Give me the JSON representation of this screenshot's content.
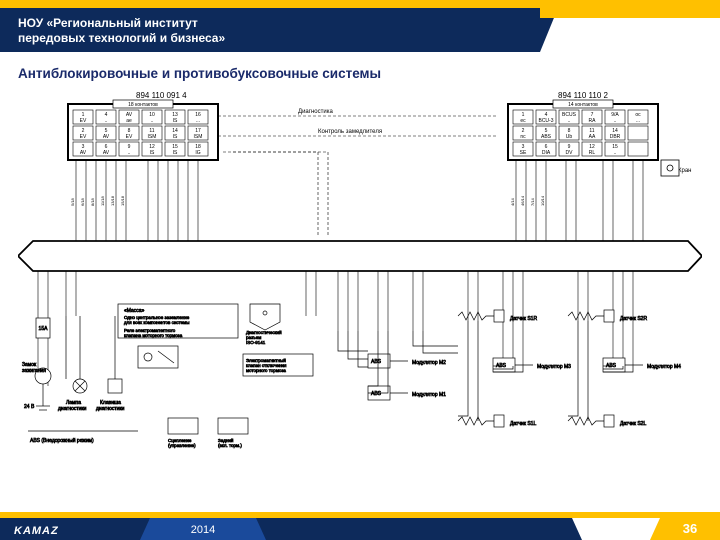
{
  "header": {
    "institution_line1": "НОУ «Региональный институт",
    "institution_line2": "передовых технологий и бизнеса»"
  },
  "title": "Антиблокировочные и противобуксовочные системы",
  "footer": {
    "logo": "KAMAZ",
    "year": "2014",
    "page": "36"
  },
  "diagram": {
    "connector_left": {
      "partno": "894 110 091 4",
      "label": "18 контактов",
      "cells_row1": [
        "1",
        "4",
        "AV",
        "10",
        "13",
        "16"
      ],
      "cells_row1_sub": [
        "EV",
        "..",
        "ae",
        "..",
        "IS",
        "..."
      ],
      "cells_row2": [
        "2",
        "5",
        "8",
        "11",
        "14",
        "17"
      ],
      "cells_row2_sub": [
        "EV",
        "AV",
        "EV",
        "ISM",
        "IS",
        "ISM"
      ],
      "cells_row3": [
        "3",
        "6",
        "9",
        "12",
        "15",
        "18"
      ],
      "cells_row3_sub": [
        "AV",
        "AV",
        "..",
        "IS",
        "IS",
        "IG"
      ]
    },
    "connector_right": {
      "partno": "894 110 110 2",
      "label": "14 контактов",
      "cells_row1": [
        "1",
        "4",
        "BCUS",
        "7",
        "9/A",
        "oc"
      ],
      "cells_row1_sub": [
        "ec",
        "BCU-3",
        "..",
        "RA",
        "..",
        "..."
      ],
      "cells_row2": [
        "2",
        "5",
        "8",
        "11",
        "14",
        ""
      ],
      "cells_row2_sub": [
        "nc",
        "ABS",
        "Ub",
        "AA",
        "DBR",
        ""
      ],
      "cells_row3": [
        "3",
        "6",
        "9",
        "12",
        "15",
        ""
      ],
      "cells_row3_sub": [
        "SE",
        "DIA",
        "DV",
        "RL",
        "..",
        ""
      ]
    },
    "top_labels": {
      "diag": "Диагностика",
      "retarder": "Контроль замедлителя",
      "brake": "Кран"
    },
    "middle_block": {
      "mass": "«Масса»",
      "central_note": "Одно центральное заземление для всех компонентов системы",
      "relay": "Реле электромагнитного клапана моторного тормоза",
      "diag_socket": "Диагностический разъем ISO-9141",
      "ev_brake": "Электромагнитный клапан отключения моторного тормоза"
    },
    "left_block": {
      "fuse": "15A",
      "ignition": "Замок зажигания",
      "volt": "24 В",
      "diag_lamp": "Лампа диагностики",
      "diag_key": "Клавиша диагностики",
      "abs_off": "ABS (Внедорожный режим)",
      "steer": "Сцепление (управление)",
      "rear": "Задний (включая торм.)"
    },
    "sensors": [
      "Датчик S1R",
      "Датчик S2R",
      "Датчик S1L",
      "Датчик S2L"
    ],
    "modulators": [
      "Модулятор M3",
      "Модулятор M4",
      "Модулятор M1",
      "Модулятор M2"
    ]
  }
}
